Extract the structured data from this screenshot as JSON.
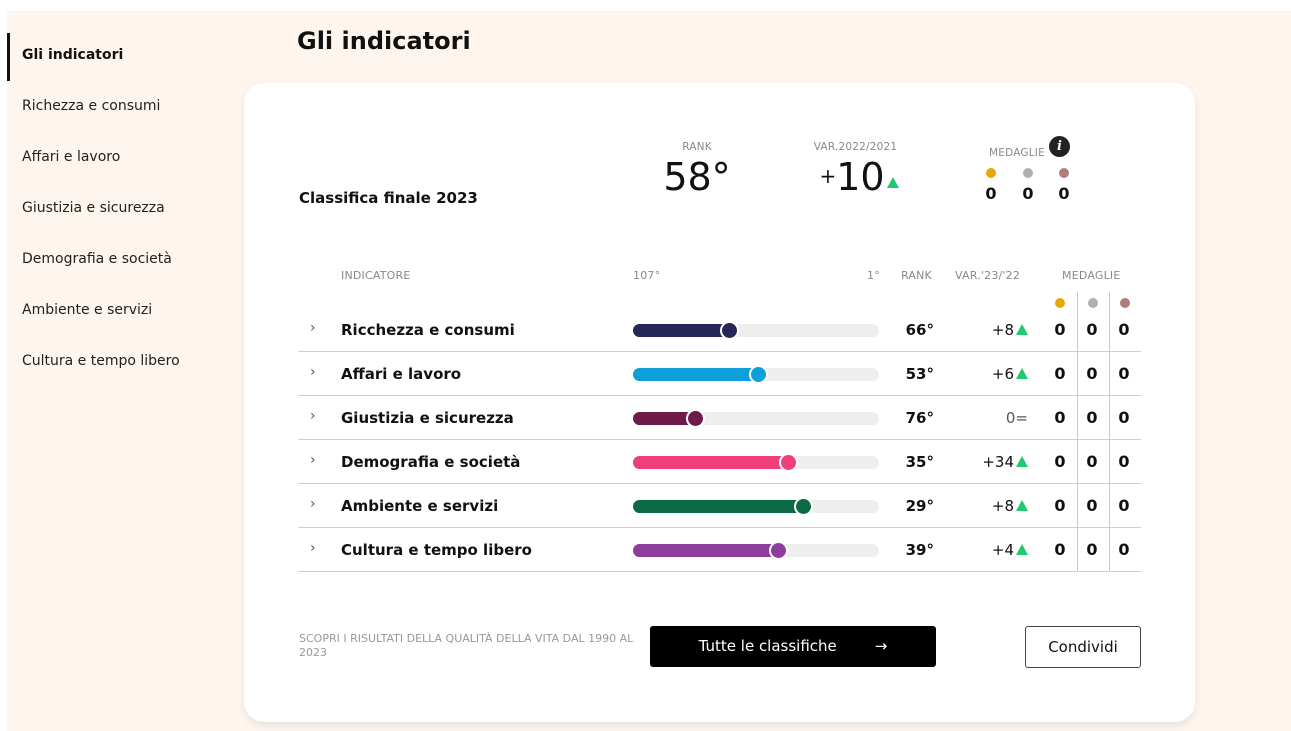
{
  "sidebar": {
    "items": [
      {
        "label": "Gli indicatori",
        "active": true
      },
      {
        "label": "Richezza e consumi"
      },
      {
        "label": "Affari e lavoro"
      },
      {
        "label": "Giustizia e sicurezza"
      },
      {
        "label": "Demografia e società"
      },
      {
        "label": "Ambiente e servizi"
      },
      {
        "label": "Cultura e tempo libero"
      }
    ]
  },
  "page_title": "Gli indicatori",
  "summary": {
    "title": "Classifica finale 2023",
    "rank_label": "RANK",
    "rank": "58°",
    "var_label": "VAR.2022/2021",
    "var_sign": "+",
    "var_value": "10",
    "medals_label": "MEDAGLIE",
    "info_icon": "i",
    "medals": [
      "0",
      "0",
      "0"
    ]
  },
  "table": {
    "headers": {
      "indicator": "INDICATORE",
      "scale_min": "107°",
      "scale_max": "1°",
      "rank": "RANK",
      "var": "VAR.'23/'22",
      "medals": "MEDAGLIE"
    },
    "rows": [
      {
        "label": "Ricchezza e consumi",
        "rank": "66°",
        "var": "+8",
        "trend": "up",
        "progress": 0.39,
        "color": "#262756",
        "medals": [
          "0",
          "0",
          "0"
        ]
      },
      {
        "label": "Affari e lavoro",
        "rank": "53°",
        "var": "+6",
        "trend": "up",
        "progress": 0.51,
        "color": "#0d9fd8",
        "medals": [
          "0",
          "0",
          "0"
        ]
      },
      {
        "label": "Giustizia e sicurezza",
        "rank": "76°",
        "var": "0=",
        "trend": "flat",
        "progress": 0.25,
        "color": "#6e1b4a",
        "medals": [
          "0",
          "0",
          "0"
        ]
      },
      {
        "label": "Demografia e società",
        "rank": "35°",
        "var": "+34",
        "trend": "up",
        "progress": 0.63,
        "color": "#ef3e7b",
        "medals": [
          "0",
          "0",
          "0"
        ]
      },
      {
        "label": "Ambiente e servizi",
        "rank": "29°",
        "var": "+8",
        "trend": "up",
        "progress": 0.69,
        "color": "#0b6a43",
        "medals": [
          "0",
          "0",
          "0"
        ]
      },
      {
        "label": "Cultura e tempo libero",
        "rank": "39°",
        "var": "+4",
        "trend": "up",
        "progress": 0.59,
        "color": "#8e3d9d",
        "medals": [
          "0",
          "0",
          "0"
        ]
      }
    ]
  },
  "medal_colors": [
    "#e6a800",
    "#b0b0b0",
    "#b07d78"
  ],
  "trend_color": "#1fc873",
  "footer": {
    "text": "SCOPRI I RISULTATI DELLA QUALITÀ DELLA VITA DAL 1990 AL 2023",
    "primary_button": "Tutte le classifiche",
    "primary_arrow": "→",
    "secondary_button": "Condividi"
  }
}
